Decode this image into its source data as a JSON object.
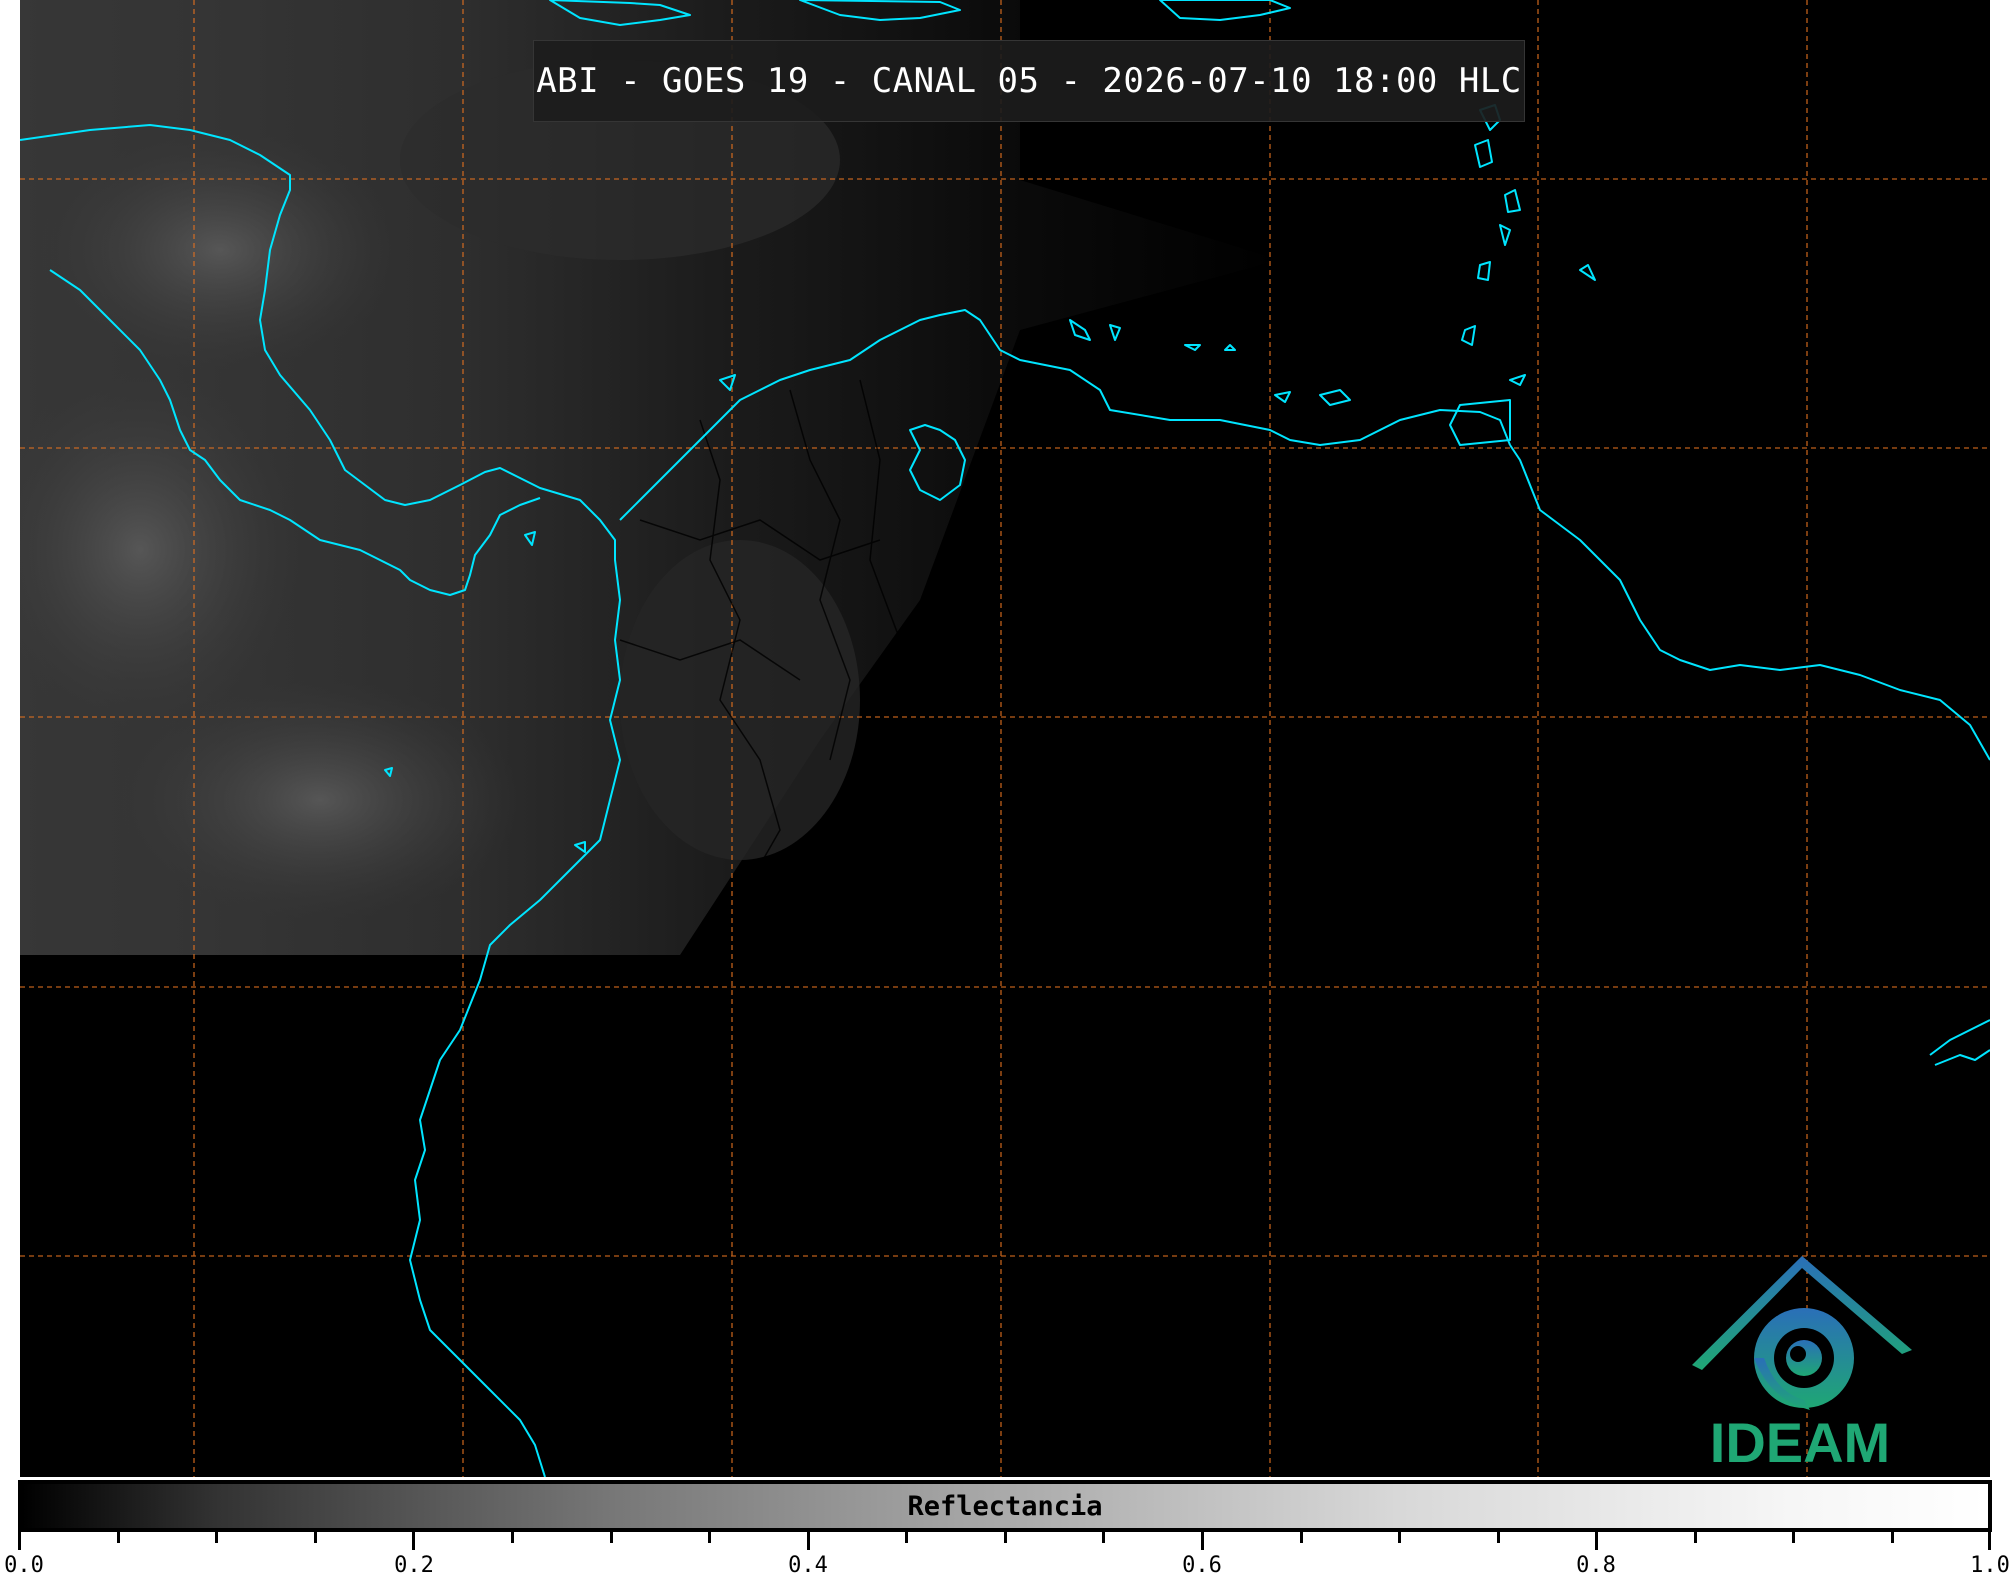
{
  "title": "ABI - GOES 19 - CANAL 05 - 2026-07-10 18:00 HLC",
  "colorbar": {
    "label": "Reflectancia",
    "range": [
      0.0,
      1.0
    ],
    "colormap": "grayscale black to white",
    "tick_labels": [
      "0.0",
      "0.2",
      "0.4",
      "0.6",
      "0.8",
      "1.0"
    ]
  },
  "logo": {
    "text": "IDEAM",
    "colors": {
      "top": "#2a6fb8",
      "bottom": "#1fa774"
    }
  },
  "colors": {
    "coastline": "#00e5ff",
    "gridlines": "#e07020",
    "background": "#000000",
    "borders": "#000000"
  }
}
